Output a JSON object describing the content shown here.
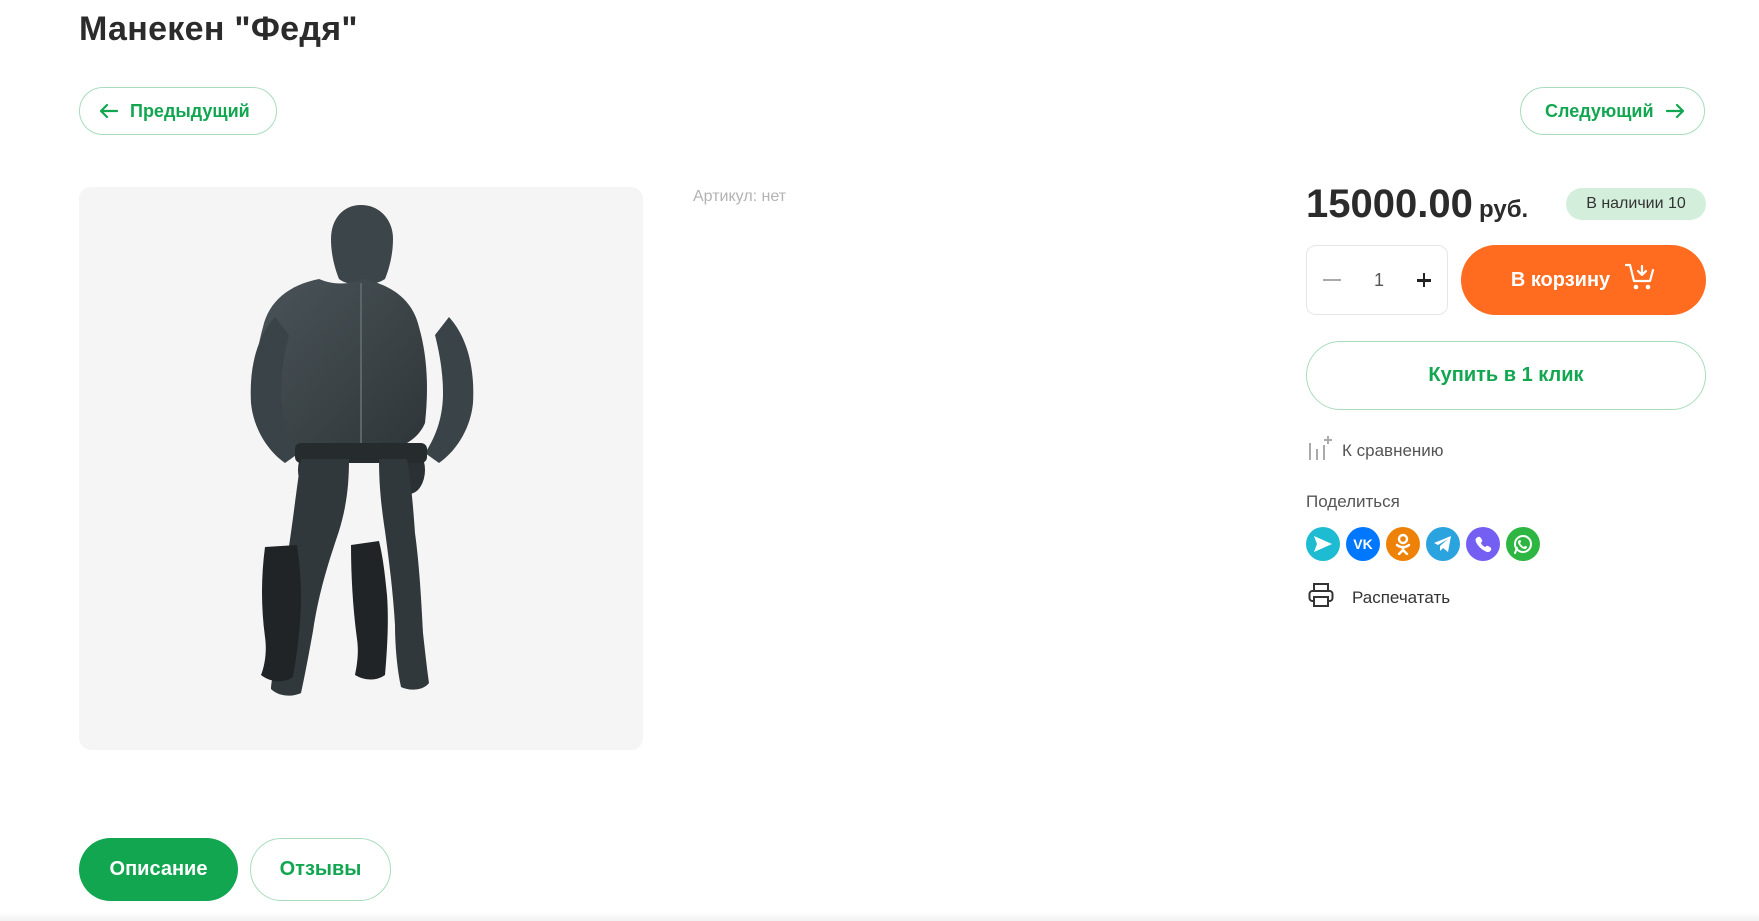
{
  "product": {
    "title": "Манекен \"Федя\"",
    "sku_label": "Артикул: нет",
    "price": "15000.00",
    "currency": "руб.",
    "stock": "В наличии 10",
    "quantity": "1"
  },
  "nav": {
    "prev_label": "Предыдущий",
    "next_label": "Следующий"
  },
  "actions": {
    "cart_label": "В корзину",
    "oneclick_label": "Купить в 1 клик",
    "compare_label": "К сравнению",
    "share_label": "Поделиться",
    "print_label": "Распечатать"
  },
  "share_icons": [
    {
      "name": "messenger-icon",
      "color": "#1dbcd2"
    },
    {
      "name": "vk-icon",
      "color": "#0077ff"
    },
    {
      "name": "odnoklassniki-icon",
      "color": "#ee8208"
    },
    {
      "name": "telegram-icon",
      "color": "#2aa3df"
    },
    {
      "name": "viber-icon",
      "color": "#7360f2"
    },
    {
      "name": "whatsapp-icon",
      "color": "#2db742"
    }
  ],
  "tabs": {
    "description": "Описание",
    "reviews": "Отзывы"
  },
  "colors": {
    "accent_green": "#12a651",
    "cart_orange": "#ff6b1f",
    "stock_badge_bg": "#d3efdb"
  }
}
